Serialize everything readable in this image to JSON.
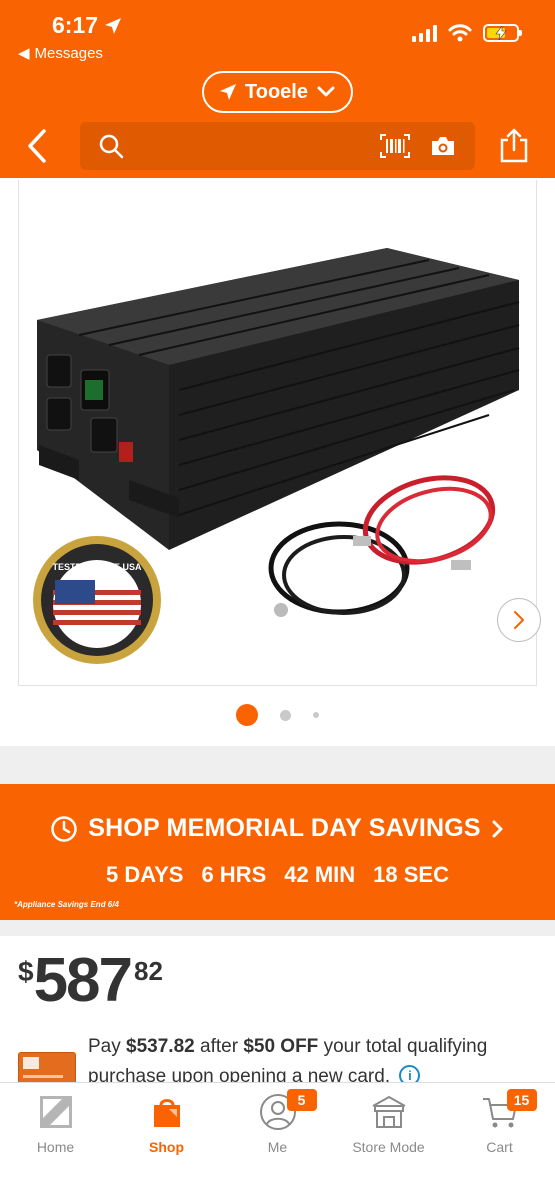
{
  "status_bar": {
    "time": "6:17",
    "back_app": "Messages"
  },
  "header": {
    "location": "Tooele",
    "search_placeholder": ""
  },
  "product": {
    "image_badge_text": "TESTED IN THE USA",
    "carousel": {
      "total": 3,
      "active": 1
    }
  },
  "banner": {
    "title": "SHOP MEMORIAL DAY SAVINGS",
    "countdown": [
      "5 DAYS",
      "6 HRS",
      "42 MIN",
      "18 SEC"
    ],
    "note": "*Appliance Savings End 6/4"
  },
  "price": {
    "dollar_sign": "$",
    "whole": "587",
    "cents": "82"
  },
  "offer": {
    "pay_prefix": "Pay",
    "pay_amount": "$537.82",
    "after_text": "after",
    "discount": "$50 OFF",
    "suffix": "your total qualifying purchase upon opening a new card.",
    "info_glyph": "i"
  },
  "bottom_nav": {
    "items": [
      {
        "label": "Home",
        "icon": "home-depot-logo-icon"
      },
      {
        "label": "Shop",
        "icon": "shopping-bag-icon"
      },
      {
        "label": "Me",
        "icon": "user-icon",
        "badge": "5"
      },
      {
        "label": "Store Mode",
        "icon": "store-icon"
      },
      {
        "label": "Cart",
        "icon": "cart-icon",
        "badge": "15"
      }
    ]
  },
  "colors": {
    "brand_orange": "#f96302",
    "info_blue": "#1a8ac8"
  }
}
